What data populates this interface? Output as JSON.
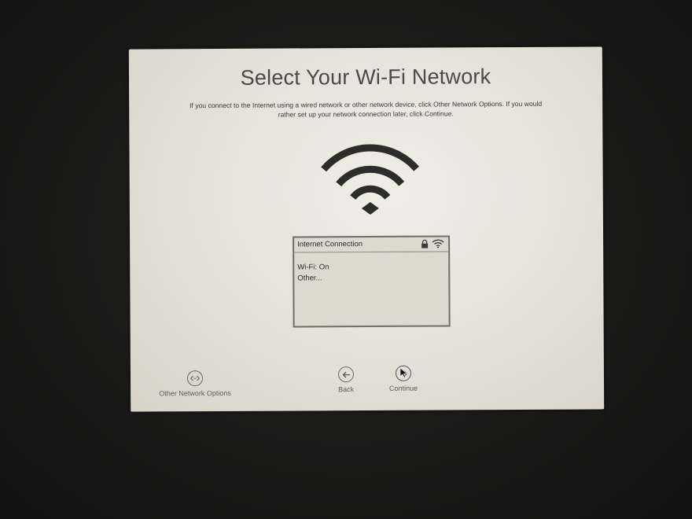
{
  "setup": {
    "title": "Select Your Wi-Fi Network",
    "subtitle": "If you connect to the Internet using a wired network or other network device, click Other Network Options. If you would rather set up your network connection later, click Continue.",
    "hero_icon": "wifi-icon",
    "network_list": {
      "header": "Internet Connection",
      "header_icons": [
        "lock-icon",
        "wifi-icon"
      ],
      "items": [
        "Wi-Fi: On",
        "Other..."
      ]
    },
    "buttons": {
      "other_network_options": "Other Network Options",
      "back": "Back",
      "continue": "Continue"
    }
  }
}
